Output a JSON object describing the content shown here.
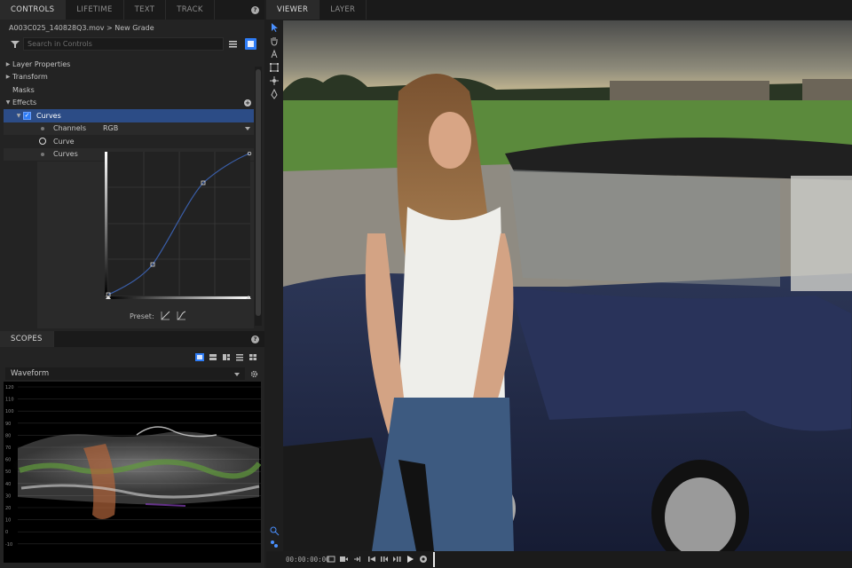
{
  "left_tabs": [
    "CONTROLS",
    "LIFETIME",
    "TEXT",
    "TRACK"
  ],
  "help_glyph": "?",
  "clip_path": "A003C025_140828Q3.mov > New Grade",
  "search": {
    "placeholder": "Search in Controls"
  },
  "tree": {
    "layer_properties": "Layer Properties",
    "transform": "Transform",
    "masks": "Masks",
    "effects": "Effects",
    "curves": "Curves",
    "channels_label": "Channels",
    "channels_value": "RGB",
    "curve_label": "Curve",
    "curves_sub": "Curves"
  },
  "preset_label": "Preset:",
  "scopes_tab": "SCOPES",
  "scope_type": "Waveform",
  "waveform_scale": [
    "120",
    "110",
    "100",
    "90",
    "80",
    "70",
    "60",
    "50",
    "40",
    "30",
    "20",
    "10",
    "0",
    "-10"
  ],
  "right_tabs": [
    "VIEWER",
    "LAYER"
  ],
  "timecode": "00:00:00:00",
  "colors": {
    "accent": "#2e7cf6",
    "selection": "#2c4c86"
  },
  "icons": [
    "filter-icon",
    "list-view-icon",
    "grid-view-icon",
    "plus-icon",
    "gear-icon",
    "select-arrow-icon",
    "hand-icon",
    "text-tool-icon",
    "transform-icon",
    "move-icon",
    "pen-icon",
    "loop-icon",
    "play-icon"
  ]
}
